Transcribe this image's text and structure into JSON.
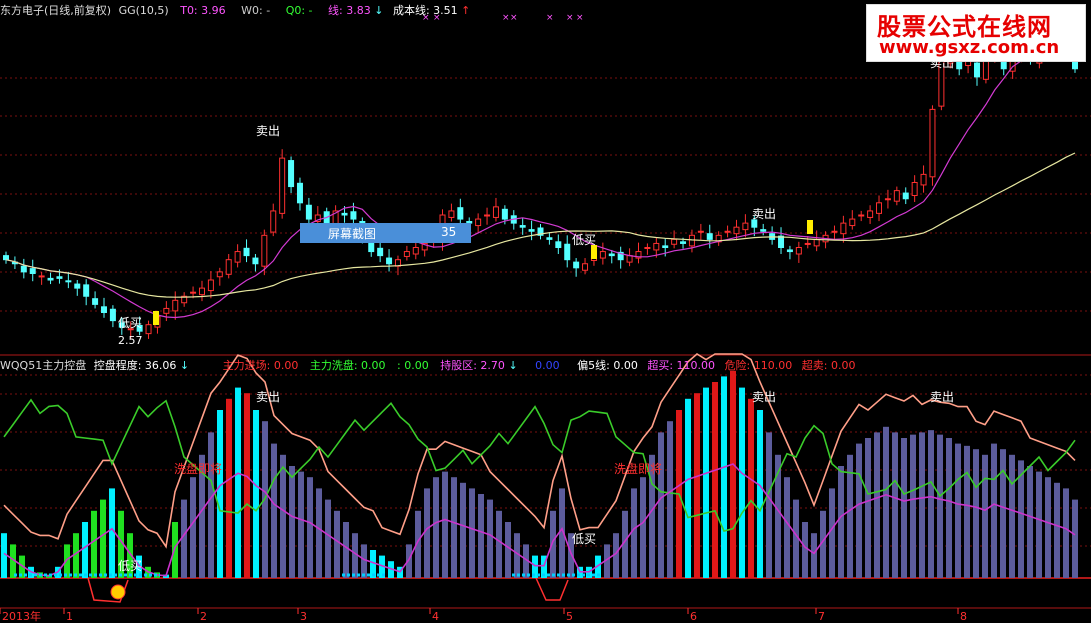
{
  "main_header": {
    "title": "东方电子(日线,前复权)",
    "gg": "GG(10,5)",
    "t0": "T0: 3.96",
    "w0": "W0: -",
    "q0": "Q0: -",
    "xian": "线: 3.83",
    "arrow_down": "↓",
    "cost_line": "成本线: 3.51",
    "arrow_up": "↑"
  },
  "indicator_header": {
    "name": "WQQ51主力控盘",
    "control": "控盘程度: 36.06",
    "control_arrow": "↓",
    "enter": "主力进场: 0.00",
    "wash": "主力洗盘: 0.00",
    "colon": ": 0.00",
    "hold": "持股区: 2.70",
    "hold_arrow": "↓",
    "blank": "0.00",
    "dev5": "偏5线: 0.00",
    "overbuy": "超买: 110.00",
    "danger": "危险: 110.00",
    "oversell": "超卖: 0.00"
  },
  "brand": {
    "name": "股票公式在线网",
    "url": "www.gsxz.com.cn"
  },
  "capture_button": {
    "label": "屏幕截图",
    "value": "35"
  },
  "annotations": {
    "sell": "卖出",
    "low_buy": "低买",
    "low_price": "2.57",
    "wash_text": "洗盘即将"
  },
  "x_axis": {
    "labels": [
      "2013年",
      "1",
      "2",
      "3",
      "4",
      "5",
      "6",
      "7",
      "8"
    ]
  },
  "colors": {
    "up": "#ff3030",
    "down": "#54ffff",
    "ma_short": "#d23ad2",
    "ma_long": "#e6e6a0",
    "bar_red": "#e01818",
    "bar_cyan": "#00f0ff",
    "bar_slate": "#5c5c9c",
    "bar_green": "#20e020",
    "line_salmon": "#ff9f88",
    "line_green": "#3acc2a",
    "line_purple": "#cc33cc"
  },
  "chart_data": {
    "type": "candlestick",
    "close": [
      3.45,
      3.4,
      3.3,
      3.28,
      3.25,
      3.2,
      3.22,
      3.18,
      3.1,
      3.0,
      2.9,
      2.8,
      2.7,
      2.62,
      2.6,
      2.57,
      2.65,
      2.75,
      2.85,
      2.95,
      3.0,
      3.05,
      3.1,
      3.2,
      3.3,
      3.45,
      3.55,
      3.5,
      3.4,
      3.75,
      4.05,
      4.7,
      4.35,
      4.15,
      3.95,
      4.0,
      3.85,
      4.05,
      4.0,
      3.95,
      3.7,
      3.55,
      3.5,
      3.4,
      3.45,
      3.55,
      3.6,
      3.65,
      3.7,
      4.0,
      4.05,
      3.95,
      3.9,
      3.95,
      4.0,
      4.1,
      3.95,
      3.9,
      3.85,
      3.8,
      3.75,
      3.7,
      3.6,
      3.45,
      3.35,
      3.4,
      3.5,
      3.55,
      3.5,
      3.45,
      3.5,
      3.55,
      3.6,
      3.65,
      3.6,
      3.7,
      3.65,
      3.75,
      3.8,
      3.7,
      3.75,
      3.8,
      3.85,
      3.9,
      3.85,
      3.8,
      3.7,
      3.6,
      3.55,
      3.6,
      3.65,
      3.7,
      3.75,
      3.8,
      3.9,
      3.95,
      4.0,
      4.05,
      4.15,
      4.2,
      4.3,
      4.2,
      4.4,
      4.5,
      5.3,
      5.9,
      6.0,
      5.8,
      5.9,
      5.7,
      5.9,
      6.0,
      5.8,
      5.95,
      6.05,
      5.9,
      6.0,
      6.1,
      6.05,
      6.15,
      5.8
    ],
    "ma_short_label": "MA",
    "vol_bars": [
      40,
      30,
      20,
      10,
      5,
      3,
      10,
      30,
      40,
      50,
      60,
      70,
      80,
      60,
      40,
      20,
      10,
      5,
      3,
      50,
      70,
      90,
      110,
      130,
      150,
      160,
      170,
      165,
      150,
      140,
      120,
      110,
      100,
      95,
      90,
      80,
      70,
      60,
      50,
      40,
      30,
      25,
      20,
      15,
      10,
      30,
      60,
      80,
      90,
      95,
      90,
      85,
      80,
      75,
      70,
      60,
      50,
      40,
      30,
      20,
      20,
      60,
      80,
      40,
      10,
      10,
      20,
      30,
      40,
      60,
      80,
      90,
      110,
      130,
      140,
      150,
      160,
      165,
      170,
      175,
      180,
      185,
      170,
      160,
      150,
      130,
      110,
      90,
      70,
      50,
      40,
      60,
      80,
      100,
      110,
      120,
      125,
      130,
      135,
      130,
      125,
      128,
      130,
      132,
      128,
      125,
      120,
      118,
      115,
      110,
      120,
      115,
      110,
      105,
      100,
      95,
      90,
      85,
      80,
      70
    ],
    "levels": {
      "overbuy": 110,
      "danger": 110,
      "oversell": 0
    }
  }
}
